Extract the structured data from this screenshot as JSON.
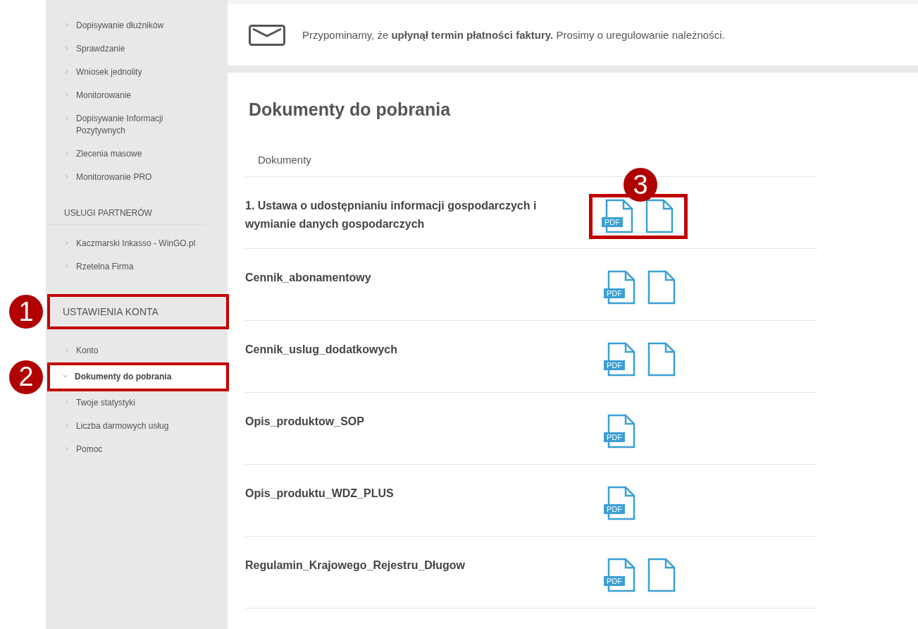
{
  "sidebar": {
    "groups": [
      {
        "items": [
          {
            "label": "Dopisywanie dłużników",
            "selected": false
          },
          {
            "label": "Sprawdzanie",
            "selected": false
          },
          {
            "label": "Wniosek jednolity",
            "selected": false
          },
          {
            "label": "Monitorowanie",
            "selected": false
          },
          {
            "label": "Dopisywanie Informacji Pozytywnych",
            "selected": false
          },
          {
            "label": "Zlecenia masowe",
            "selected": false
          },
          {
            "label": "Monitorowanie PRO",
            "selected": false
          }
        ]
      },
      {
        "heading": "USŁUGI PARTNERÓW",
        "items": [
          {
            "label": "Kaczmarski Inkasso - WinGO.pl",
            "selected": false
          },
          {
            "label": "Rzetelna Firma",
            "selected": false
          }
        ]
      },
      {
        "heading": "USTAWIENIA KONTA",
        "heading_callout": "1",
        "items": [
          {
            "label": "Konto",
            "selected": false
          },
          {
            "label": "Dokumenty do pobrania",
            "selected": true,
            "callout": "2"
          },
          {
            "label": "Twoje statystyki",
            "selected": false
          },
          {
            "label": "Liczba darmowych usług",
            "selected": false
          },
          {
            "label": "Pomoc",
            "selected": false
          }
        ]
      }
    ]
  },
  "notice": {
    "text": "Przypominamy, że **upłynął termin płatności faktury.** Prosimy o uregulowanie należności."
  },
  "page_title": "Dokumenty do pobrania",
  "table": {
    "column_header": "Dokumenty",
    "rows": [
      {
        "name": "1. Ustawa o udostępnianiu informacji gospodarczych i wymianie danych gospodarczych",
        "pdf_label": "PDF",
        "has_file": true,
        "callout": "3"
      },
      {
        "name": "Cennik_abonamentowy",
        "pdf_label": "PDF",
        "has_file": true
      },
      {
        "name": "Cennik_uslug_dodatkowych",
        "pdf_label": "PDF",
        "has_file": true
      },
      {
        "name": "Opis_produktow_SOP",
        "pdf_label": "PDF",
        "has_file": false
      },
      {
        "name": "Opis_produktu_WDZ_PLUS",
        "pdf_label": "PDF",
        "has_file": false
      },
      {
        "name": "Regulamin_Krajowego_Rejestru_Długow",
        "pdf_label": "PDF",
        "has_file": true
      }
    ]
  }
}
